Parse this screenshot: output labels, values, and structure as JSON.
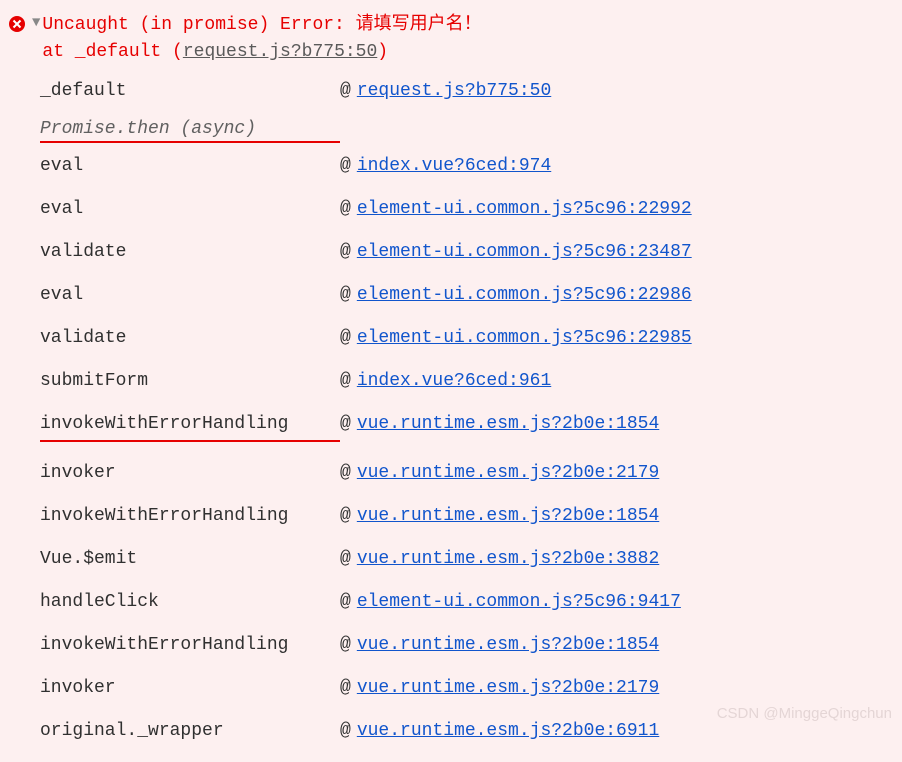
{
  "error": {
    "message": "Uncaught (in promise) Error: 请填写用户名！",
    "at_prefix": "    at _default (",
    "at_link": "request.js?b775:50",
    "at_suffix": ")"
  },
  "top_frame": {
    "fn": "_default",
    "at": "@",
    "link": "request.js?b775:50"
  },
  "async_label": "Promise.then (async)",
  "frames": [
    {
      "fn": "eval",
      "link": "index.vue?6ced:974"
    },
    {
      "fn": "eval",
      "link": "element-ui.common.js?5c96:22992"
    },
    {
      "fn": "validate",
      "link": "element-ui.common.js?5c96:23487"
    },
    {
      "fn": "eval",
      "link": "element-ui.common.js?5c96:22986"
    },
    {
      "fn": "validate",
      "link": "element-ui.common.js?5c96:22985"
    },
    {
      "fn": "submitForm",
      "link": "index.vue?6ced:961"
    },
    {
      "fn": "invokeWithErrorHandling",
      "link": "vue.runtime.esm.js?2b0e:1854"
    },
    {
      "fn": "invoker",
      "link": "vue.runtime.esm.js?2b0e:2179"
    },
    {
      "fn": "invokeWithErrorHandling",
      "link": "vue.runtime.esm.js?2b0e:1854"
    },
    {
      "fn": "Vue.$emit",
      "link": "vue.runtime.esm.js?2b0e:3882"
    },
    {
      "fn": "handleClick",
      "link": "element-ui.common.js?5c96:9417"
    },
    {
      "fn": "invokeWithErrorHandling",
      "link": "vue.runtime.esm.js?2b0e:1854"
    },
    {
      "fn": "invoker",
      "link": "vue.runtime.esm.js?2b0e:2179"
    },
    {
      "fn": "original._wrapper",
      "link": "vue.runtime.esm.js?2b0e:6911"
    }
  ],
  "at_symbol": "@",
  "watermark": "CSDN @MinggeQingchun"
}
